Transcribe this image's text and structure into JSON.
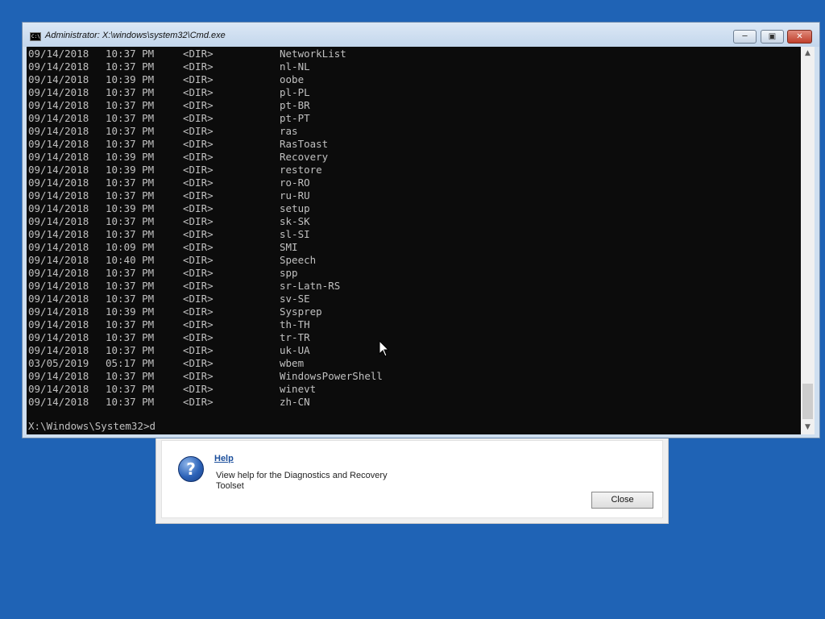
{
  "cmd_window": {
    "title": "Administrator: X:\\windows\\system32\\Cmd.exe",
    "icon": "cmd-icon",
    "buttons": {
      "minimize": "minimize-icon",
      "maximize": "maximize-icon",
      "close": "close-icon"
    },
    "listing": [
      {
        "date": "09/14/2018",
        "time": "10:37 PM",
        "type": "<DIR>",
        "name": "NetworkList"
      },
      {
        "date": "09/14/2018",
        "time": "10:37 PM",
        "type": "<DIR>",
        "name": "nl-NL"
      },
      {
        "date": "09/14/2018",
        "time": "10:39 PM",
        "type": "<DIR>",
        "name": "oobe"
      },
      {
        "date": "09/14/2018",
        "time": "10:37 PM",
        "type": "<DIR>",
        "name": "pl-PL"
      },
      {
        "date": "09/14/2018",
        "time": "10:37 PM",
        "type": "<DIR>",
        "name": "pt-BR"
      },
      {
        "date": "09/14/2018",
        "time": "10:37 PM",
        "type": "<DIR>",
        "name": "pt-PT"
      },
      {
        "date": "09/14/2018",
        "time": "10:37 PM",
        "type": "<DIR>",
        "name": "ras"
      },
      {
        "date": "09/14/2018",
        "time": "10:37 PM",
        "type": "<DIR>",
        "name": "RasToast"
      },
      {
        "date": "09/14/2018",
        "time": "10:39 PM",
        "type": "<DIR>",
        "name": "Recovery"
      },
      {
        "date": "09/14/2018",
        "time": "10:39 PM",
        "type": "<DIR>",
        "name": "restore"
      },
      {
        "date": "09/14/2018",
        "time": "10:37 PM",
        "type": "<DIR>",
        "name": "ro-RO"
      },
      {
        "date": "09/14/2018",
        "time": "10:37 PM",
        "type": "<DIR>",
        "name": "ru-RU"
      },
      {
        "date": "09/14/2018",
        "time": "10:39 PM",
        "type": "<DIR>",
        "name": "setup"
      },
      {
        "date": "09/14/2018",
        "time": "10:37 PM",
        "type": "<DIR>",
        "name": "sk-SK"
      },
      {
        "date": "09/14/2018",
        "time": "10:37 PM",
        "type": "<DIR>",
        "name": "sl-SI"
      },
      {
        "date": "09/14/2018",
        "time": "10:09 PM",
        "type": "<DIR>",
        "name": "SMI"
      },
      {
        "date": "09/14/2018",
        "time": "10:40 PM",
        "type": "<DIR>",
        "name": "Speech"
      },
      {
        "date": "09/14/2018",
        "time": "10:37 PM",
        "type": "<DIR>",
        "name": "spp"
      },
      {
        "date": "09/14/2018",
        "time": "10:37 PM",
        "type": "<DIR>",
        "name": "sr-Latn-RS"
      },
      {
        "date": "09/14/2018",
        "time": "10:37 PM",
        "type": "<DIR>",
        "name": "sv-SE"
      },
      {
        "date": "09/14/2018",
        "time": "10:39 PM",
        "type": "<DIR>",
        "name": "Sysprep"
      },
      {
        "date": "09/14/2018",
        "time": "10:37 PM",
        "type": "<DIR>",
        "name": "th-TH"
      },
      {
        "date": "09/14/2018",
        "time": "10:37 PM",
        "type": "<DIR>",
        "name": "tr-TR"
      },
      {
        "date": "09/14/2018",
        "time": "10:37 PM",
        "type": "<DIR>",
        "name": "uk-UA"
      },
      {
        "date": "03/05/2019",
        "time": "05:17 PM",
        "type": "<DIR>",
        "name": "wbem"
      },
      {
        "date": "09/14/2018",
        "time": "10:37 PM",
        "type": "<DIR>",
        "name": "WindowsPowerShell"
      },
      {
        "date": "09/14/2018",
        "time": "10:37 PM",
        "type": "<DIR>",
        "name": "winevt"
      },
      {
        "date": "09/14/2018",
        "time": "10:37 PM",
        "type": "<DIR>",
        "name": "zh-CN"
      }
    ],
    "prompt": "X:\\Windows\\System32>d"
  },
  "help_dialog": {
    "link": "Help",
    "description": "View help for the Diagnostics and Recovery Toolset",
    "close_label": "Close",
    "icon": "help-question-icon"
  },
  "colors": {
    "desktop": "#1f63b5",
    "console_bg": "#0c0c0c",
    "console_text": "#c0c0c0"
  }
}
